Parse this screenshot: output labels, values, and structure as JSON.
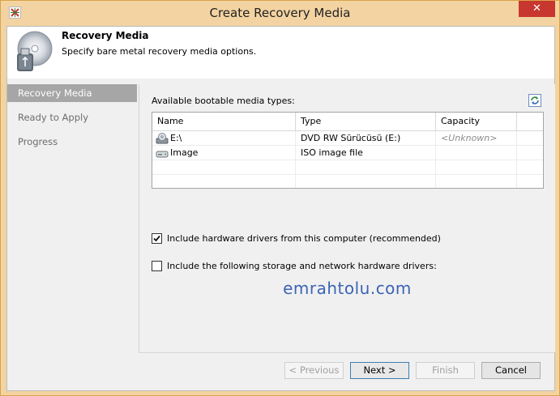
{
  "window": {
    "title": "Create Recovery Media",
    "close_glyph": "✕"
  },
  "header": {
    "title": "Recovery Media",
    "description": "Specify bare metal recovery media options.",
    "icon": "disc-usb-icon"
  },
  "nav": {
    "items": [
      {
        "label": "Recovery Media",
        "active": true
      },
      {
        "label": "Ready to Apply",
        "active": false
      },
      {
        "label": "Progress",
        "active": false
      }
    ]
  },
  "media": {
    "label": "Available bootable media types:",
    "refresh_icon": "refresh-icon",
    "columns": [
      "Name",
      "Type",
      "Capacity"
    ],
    "rows": [
      {
        "name": "E:\\",
        "type": "DVD RW Sürücüsü (E:)",
        "capacity": "<Unknown>",
        "icon": "dvd-drive-icon"
      },
      {
        "name": "Image",
        "type": "ISO image file",
        "capacity": "",
        "icon": "disk-image-icon"
      }
    ]
  },
  "options": {
    "include_hw_drivers": {
      "label": "Include hardware drivers from this computer (recommended)",
      "checked": true
    },
    "include_storage_drivers": {
      "label": "Include the following storage and network hardware drivers:",
      "checked": false
    }
  },
  "watermark": "emrahtolu.com",
  "buttons": {
    "previous": "< Previous",
    "next": "Next >",
    "finish": "Finish",
    "cancel": "Cancel"
  },
  "colors": {
    "window_frame": "#f3d3a1",
    "close_button": "#c7372f",
    "nav_active": "#a6a6a6",
    "watermark": "#3c64b4"
  }
}
